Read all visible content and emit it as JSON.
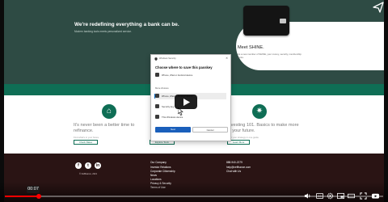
{
  "hero": {
    "title": "We're redefining everything a bank can be.",
    "subtitle": "Modern banking tools meets personalized service.",
    "panel_title": "Meet SHINE.",
    "panel_text": "As a new member of SHINE, your money, security, membership perks."
  },
  "features": [
    {
      "title_line1": "It's never been a better time to",
      "title_line2": "refinance.",
      "text": "Find what's in your future",
      "button": "Check Rates"
    },
    {
      "title_line1": "",
      "title_line2": "",
      "text": "",
      "button": "Explore Tools"
    },
    {
      "title_line1": "Investing 101. Basics to make more",
      "title_line2": "of your future.",
      "text": "Start your strategy in one guide",
      "button": "Learn More"
    }
  ],
  "dialog": {
    "window_title": "Windows Security",
    "heading": "Choose where to save this passkey",
    "options": [
      {
        "label": "iPhone, iPad or Android device",
        "icon": "phone-icon"
      },
      {
        "label": "iPhone, iPad or Android device",
        "icon": "phone-icon",
        "selected": true
      },
      {
        "label": "Security key",
        "icon": "usb-key-icon"
      },
      {
        "label": "This Windows device",
        "icon": "windows-device-icon"
      }
    ],
    "more_choices": "More choices",
    "next": "Next",
    "cancel": "Cancel"
  },
  "footer": {
    "copyright": "© NeffHance, 2021",
    "links_col1": [
      "Our Company",
      "Investor Relations",
      "Corporate Citizenship",
      "News",
      "Locations",
      "Privacy & Security",
      "Terms of Use"
    ],
    "links_col2": [
      "888-940-2279",
      "help@neffhance.com",
      "Chat with Us"
    ],
    "social": [
      "f",
      "t",
      "in"
    ]
  },
  "player": {
    "current_time": "00:07",
    "progress_fraction": 0.09,
    "accent_color": "#ff0000"
  },
  "colors": {
    "hero_bg": "#2e4b44",
    "brand_green": "#0f6e55",
    "footer_bg": "#2a1414",
    "primary_button": "#1a5fbb"
  }
}
